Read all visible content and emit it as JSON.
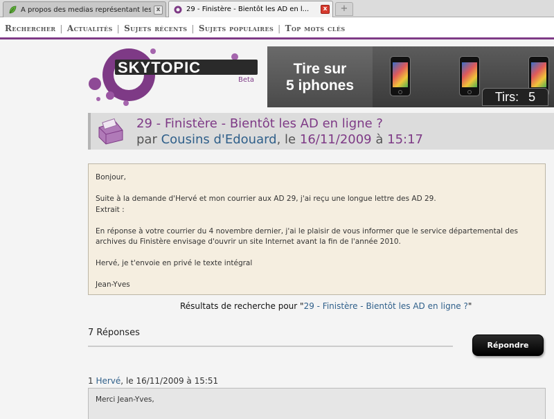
{
  "browser": {
    "tabs": [
      {
        "title": "A propos des medias représentant les i...",
        "active": false,
        "favicon": "leaf-icon"
      },
      {
        "title": "29 - Finistère - Bientôt les AD en l...",
        "active": true,
        "favicon": "skytopic-icon"
      }
    ],
    "close_glyph": "x",
    "new_tab_glyph": "+"
  },
  "nav": {
    "items": [
      "Rechercher",
      "Actualités",
      "Sujets récents",
      "Sujets populaires",
      "Top mots clés"
    ],
    "separator": "|"
  },
  "logo": {
    "name": "SKYTOPIC",
    "tag": "Beta"
  },
  "banner": {
    "line1": "Tire sur",
    "line2": "5 iphones",
    "counter_label": "Tirs:",
    "counter_value": "5"
  },
  "topic": {
    "title": "29 - Finistère - Bientôt les AD en ligne ?",
    "by_prefix": "par",
    "author": "Cousins d'Edouard",
    "date_prefix": ", le",
    "date": "16/11/2009",
    "time_prefix": "à",
    "time": "15:17"
  },
  "post": {
    "paragraphs": [
      "Bonjour,",
      "Suite à la demande d'Hervé et mon courrier aux AD 29, j'ai reçu une longue lettre des AD 29.",
      "Extrait :",
      "En réponse à votre courrier du 4 novembre dernier, j'ai le plaisir de vous informer que le service départemental des archives du Finistère envisage d'ouvrir un site Internet avant la fin de l'année 2010.",
      "Hervé, je t'envoie en privé le texte intégral",
      "Jean-Yves"
    ]
  },
  "results": {
    "prefix": "Résultats de recherche pour \"",
    "query": "29 - Finistère - Bientôt les AD en ligne ?",
    "suffix": "\""
  },
  "replies": {
    "count_label": "7 Réponses",
    "reply_button": "Répondre",
    "first": {
      "number": "1",
      "author": "Hervé",
      "date_text": ", le 16/11/2009 à 15:51",
      "body": "Merci Jean-Yves,"
    }
  },
  "colors": {
    "accent": "#7e3a86",
    "link": "#2f5f8a",
    "post_bg": "#f5eee0"
  }
}
